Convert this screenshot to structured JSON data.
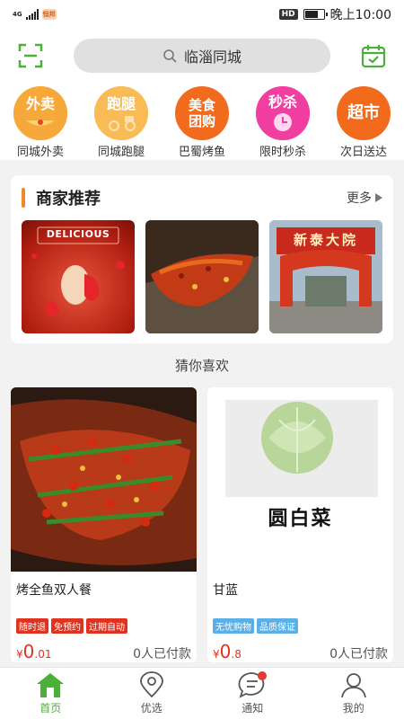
{
  "status_bar": {
    "network": "4G",
    "app_badge": "恒邦",
    "hd": "HD",
    "time": "晚上10:00"
  },
  "header": {
    "search_text": "临淄同城"
  },
  "categories": [
    {
      "icon_text": "外卖",
      "label": "同城外卖",
      "color": "#f5a623"
    },
    {
      "icon_text": "跑腿",
      "label": "同城跑腿",
      "color": "#f7b84b"
    },
    {
      "icon_text": "美食\n团购",
      "label": "巴蜀烤鱼",
      "color": "#f26b1d"
    },
    {
      "icon_text": "秒杀",
      "label": "限时秒杀",
      "color": "#f03fa0"
    },
    {
      "icon_text": "超市",
      "label": "次日送达",
      "color": "#f26b1d"
    }
  ],
  "merchant": {
    "title": "商家推荐",
    "more": "更多",
    "image1_caption": "DELICIOUS",
    "image3_caption": "新泰大院"
  },
  "guess_title": "猜你喜欢",
  "products": [
    {
      "name": "烤全鱼双人餐",
      "tags": [
        "随时退",
        "免预约",
        "过期自动"
      ],
      "price_symbol": "¥",
      "price_int": "0",
      "price_dec": ".01",
      "sold": "0人已付款"
    },
    {
      "name": "甘蓝",
      "image_text": "圆白菜",
      "tags": [
        "无忧购物",
        "品质保证"
      ],
      "price_symbol": "¥",
      "price_int": "0",
      "price_dec": ".8",
      "sold": "0人已付款"
    }
  ],
  "tabs": [
    {
      "label": "首页",
      "icon": "home-icon"
    },
    {
      "label": "优选",
      "icon": "location-icon"
    },
    {
      "label": "通知",
      "icon": "chat-icon"
    },
    {
      "label": "我的",
      "icon": "person-icon"
    }
  ],
  "colors": {
    "accent": "#4caf3a",
    "price": "#e0331f",
    "tag_red": "#e0331f",
    "tag_blue": "#5ab0e6"
  }
}
